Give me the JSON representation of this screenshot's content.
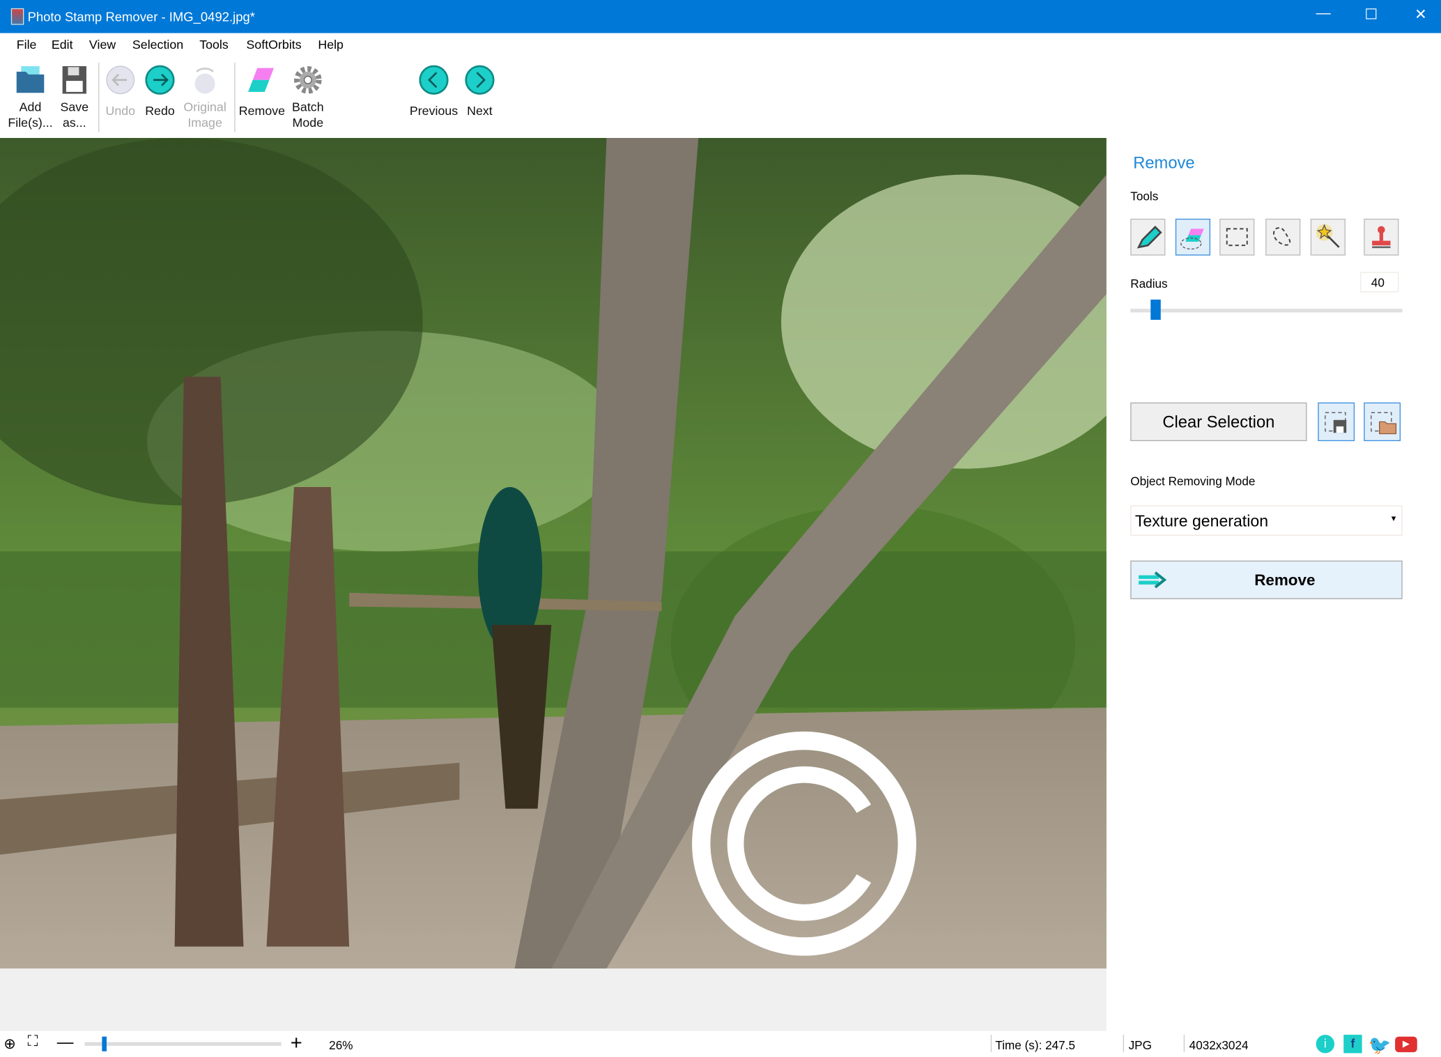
{
  "window": {
    "title": "Photo Stamp Remover - IMG_0492.jpg*",
    "minimize": "—",
    "maximize": "☐",
    "close": "✕"
  },
  "menu": [
    "File",
    "Edit",
    "View",
    "Selection",
    "Tools",
    "SoftOrbits",
    "Help"
  ],
  "toolbar": {
    "add_files": [
      "Add",
      "File(s)..."
    ],
    "save_as": [
      "Save",
      "as..."
    ],
    "undo": "Undo",
    "redo": "Redo",
    "original_image": [
      "Original",
      "Image"
    ],
    "remove": "Remove",
    "batch_mode": [
      "Batch",
      "Mode"
    ],
    "previous": "Previous",
    "next": "Next"
  },
  "panel": {
    "title": "Remove",
    "tools_label": "Tools",
    "tools": [
      "marker-icon",
      "eraser-icon",
      "rect-select-icon",
      "lasso-icon",
      "magic-wand-icon",
      "stamp-icon"
    ],
    "selected_tool": "eraser-icon",
    "radius_label": "Radius",
    "radius_value": "40",
    "radius_fraction": 0.09,
    "clear_selection": "Clear Selection",
    "mode_label": "Object Removing Mode",
    "mode_value": "Texture generation",
    "remove_button": "Remove"
  },
  "status": {
    "zoom": "26%",
    "zoom_fraction": 0.1,
    "time": "Time (s): 247.5",
    "format": "JPG",
    "dimensions": "4032x3024"
  },
  "colors": {
    "accent": "#0078d7",
    "teal": "#1ccfc9",
    "title_blue": "#1e88d6"
  }
}
